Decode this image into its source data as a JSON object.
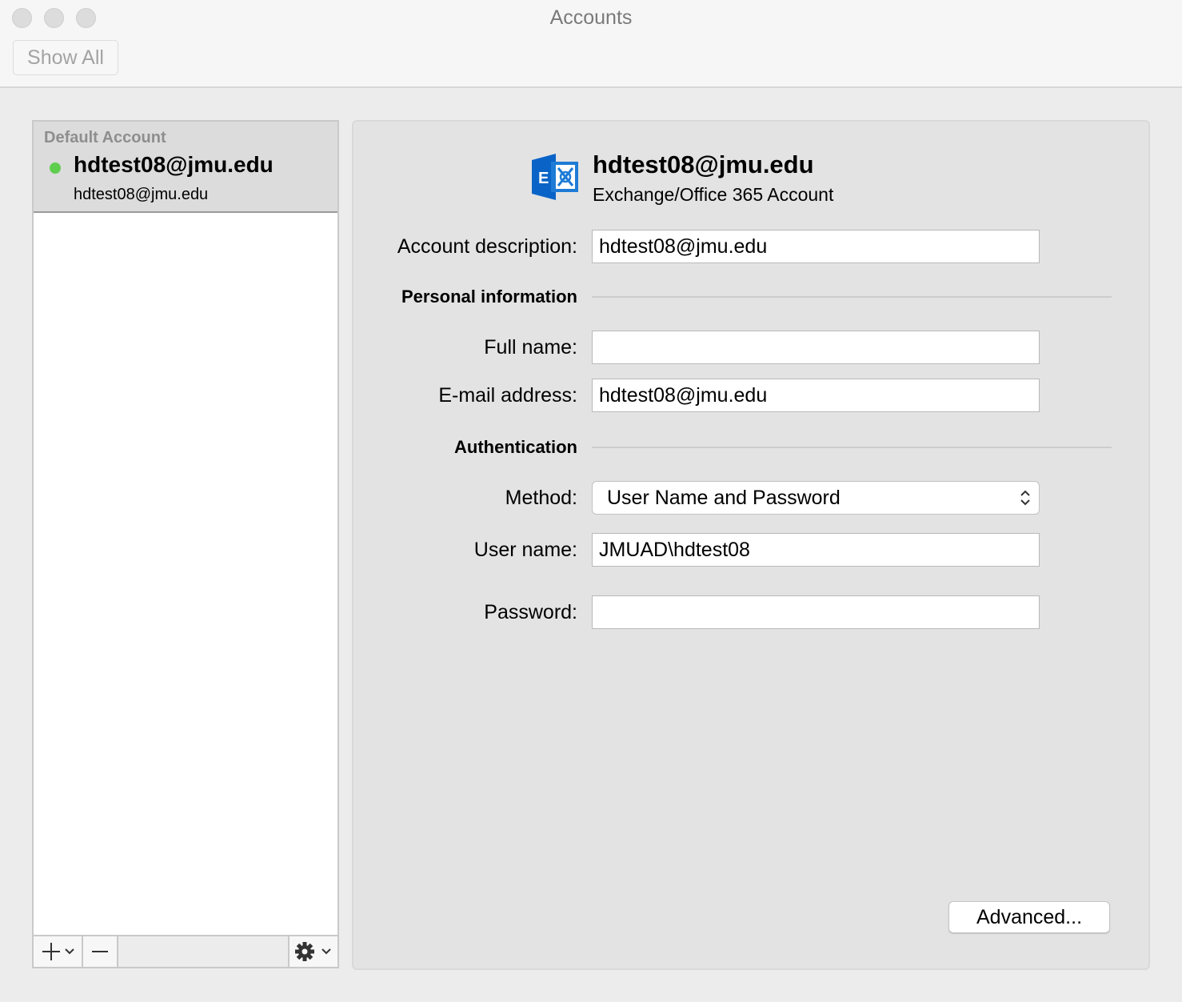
{
  "window": {
    "title": "Accounts"
  },
  "toolbar": {
    "show_all_label": "Show All"
  },
  "sidebar": {
    "section_label": "Default Account",
    "accounts": [
      {
        "name": "hdtest08@jmu.edu",
        "email": "hdtest08@jmu.edu",
        "status": "online"
      }
    ],
    "footer": {
      "add_icon": "plus-chevron-icon",
      "remove_icon": "minus-icon",
      "actions_icon": "gear-chevron-icon"
    }
  },
  "details": {
    "header_email": "hdtest08@jmu.edu",
    "account_type": "Exchange/Office 365 Account",
    "account_description_label": "Account description:",
    "account_description_value": "hdtest08@jmu.edu",
    "personal_section": "Personal information",
    "full_name_label": "Full name:",
    "full_name_value": "",
    "email_label": "E-mail address:",
    "email_value": "hdtest08@jmu.edu",
    "auth_section": "Authentication",
    "method_label": "Method:",
    "method_value": "User Name and Password",
    "username_label": "User name:",
    "username_value": "JMUAD\\hdtest08",
    "password_label": "Password:",
    "password_value": "",
    "advanced_label": "Advanced..."
  },
  "colors": {
    "status_online": "#5fce4f",
    "exchange_blue": "#0a64c8"
  }
}
